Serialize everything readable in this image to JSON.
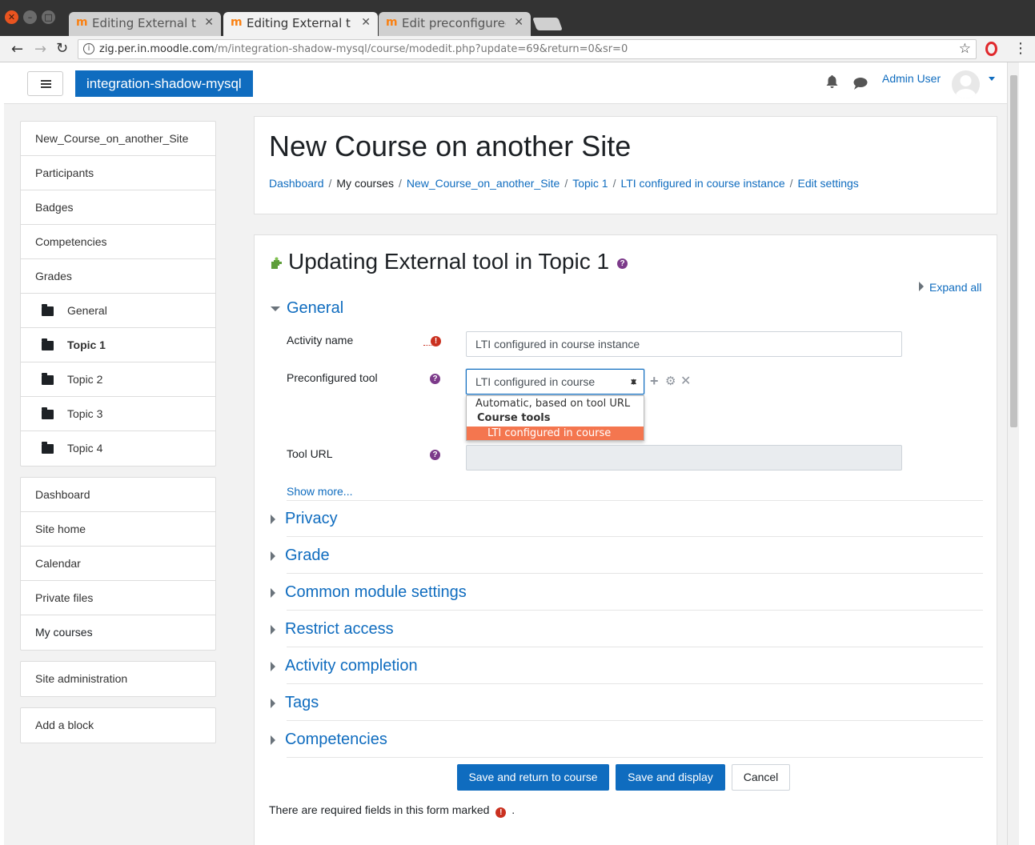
{
  "browser": {
    "tabs": [
      {
        "label": "Editing External tool"
      },
      {
        "label": "Editing External tool"
      },
      {
        "label": "Edit preconfigured"
      }
    ],
    "url_host": "zig.per.in.moodle.com",
    "url_path": "/m/integration-shadow-mysql/course/modedit.php?update=69&return=0&sr=0"
  },
  "navbar": {
    "brand": "integration-shadow-mysql",
    "user": "Admin User"
  },
  "sidebar": {
    "course": [
      "New_Course_on_another_Site",
      "Participants",
      "Badges",
      "Competencies",
      "Grades"
    ],
    "sections": [
      "General",
      "Topic 1",
      "Topic 2",
      "Topic 3",
      "Topic 4"
    ],
    "global": [
      "Dashboard",
      "Site home",
      "Calendar",
      "Private files",
      "My courses"
    ],
    "admin": "Site administration",
    "add_block": "Add a block"
  },
  "header": {
    "title": "New Course on another Site",
    "breadcrumb": [
      "Dashboard",
      "My courses",
      "New_Course_on_another_Site",
      "Topic 1",
      "LTI configured in course instance",
      "Edit settings"
    ]
  },
  "form": {
    "heading": "Updating External tool in Topic 1",
    "expand_all": "Expand all",
    "general": "General",
    "activity_name_label": "Activity name",
    "activity_name_value": "LTI configured in course instance",
    "preconfigured_label": "Preconfigured tool",
    "preconfigured_value": "LTI configured in course",
    "dropdown": {
      "option_auto": "Automatic, based on tool URL",
      "group": "Course tools",
      "option_selected": "LTI configured in course"
    },
    "tool_url_label": "Tool URL",
    "show_more": "Show more...",
    "sections": [
      "Privacy",
      "Grade",
      "Common module settings",
      "Restrict access",
      "Activity completion",
      "Tags",
      "Competencies"
    ],
    "buttons": {
      "save_return": "Save and return to course",
      "save_display": "Save and display",
      "cancel": "Cancel"
    },
    "required_note": "There are required fields in this form marked",
    "required_dot": "."
  }
}
